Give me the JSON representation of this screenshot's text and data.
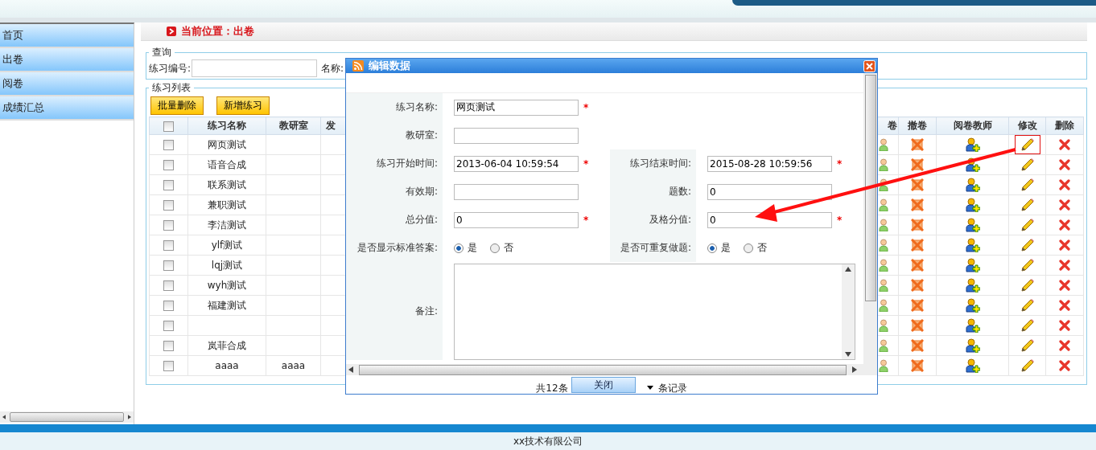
{
  "sidebar": {
    "items": [
      {
        "label": "首页"
      },
      {
        "label": "出卷"
      },
      {
        "label": "阅卷"
      },
      {
        "label": "成绩汇总"
      }
    ]
  },
  "breadcrumb": "当前位置：出卷",
  "query": {
    "legend": "查询",
    "fields": [
      {
        "label": "练习编号:"
      },
      {
        "label": "名称:"
      }
    ]
  },
  "list": {
    "legend": "练习列表",
    "buttons": [
      "批量删除",
      "新增练习"
    ],
    "all_checked": false,
    "columns": [
      "练习名称",
      "教研室",
      "发",
      "卷",
      "撤卷",
      "阅卷教师",
      "修改",
      "删除"
    ],
    "rows": [
      {
        "name": "网页测试",
        "office": "",
        "checked": false,
        "highlighted": true
      },
      {
        "name": "语音合成",
        "office": "",
        "checked": false,
        "highlighted": false
      },
      {
        "name": "联系测试",
        "office": "",
        "checked": false,
        "highlighted": false
      },
      {
        "name": "兼职测试",
        "office": "",
        "checked": false,
        "highlighted": false
      },
      {
        "name": "李洁测试",
        "office": "",
        "checked": false,
        "highlighted": false
      },
      {
        "name": "ylf测试",
        "office": "",
        "checked": false,
        "highlighted": false
      },
      {
        "name": "lqj测试",
        "office": "",
        "checked": false,
        "highlighted": false
      },
      {
        "name": "wyh测试",
        "office": "",
        "checked": false,
        "highlighted": false
      },
      {
        "name": "福建测试",
        "office": "",
        "checked": false,
        "highlighted": false
      },
      {
        "name": "",
        "office": "",
        "checked": false,
        "highlighted": false
      },
      {
        "name": "岚菲合成",
        "office": "",
        "checked": false,
        "highlighted": false
      },
      {
        "name": "aaaa",
        "office": "aaaa",
        "checked": false,
        "highlighted": false
      }
    ]
  },
  "dialog": {
    "title": "编辑数据",
    "rows": [
      [
        {
          "label": "练习名称:",
          "kind": "input",
          "value": "网页测试",
          "required_mark": "*"
        }
      ],
      [
        {
          "label": "教研室:",
          "kind": "input"
        }
      ],
      [
        {
          "label": "练习开始时间:",
          "kind": "input",
          "value": "2013-06-04 10:59:54",
          "required_mark": "*"
        },
        {
          "label": "练习结束时间:",
          "kind": "input",
          "value": "2015-08-28 10:59:56",
          "required_mark": "*"
        }
      ],
      [
        {
          "label": "有效期:",
          "kind": "input"
        },
        {
          "label": "题数:",
          "kind": "input",
          "value": "0"
        }
      ],
      [
        {
          "label": "总分值:",
          "kind": "input",
          "value": "0",
          "required_mark": "*"
        },
        {
          "label": "及格分值:",
          "kind": "input",
          "value": "0",
          "required_mark": "*"
        }
      ],
      [
        {
          "label": "是否显示标准答案:",
          "kind": "radio",
          "options": [
            {
              "label": "是",
              "selected": true
            },
            {
              "label": "否",
              "selected": false
            }
          ]
        },
        {
          "label": "是否可重复做题:",
          "kind": "radio",
          "options": [
            {
              "label": "是",
              "selected": true
            },
            {
              "label": "否",
              "selected": false
            }
          ]
        }
      ],
      [
        {
          "label": "备注:",
          "kind": "textarea"
        }
      ]
    ],
    "pager": {
      "total": "共12条",
      "suffix": "条记录"
    },
    "close": "关闭"
  },
  "footer": "xx技术有限公司"
}
